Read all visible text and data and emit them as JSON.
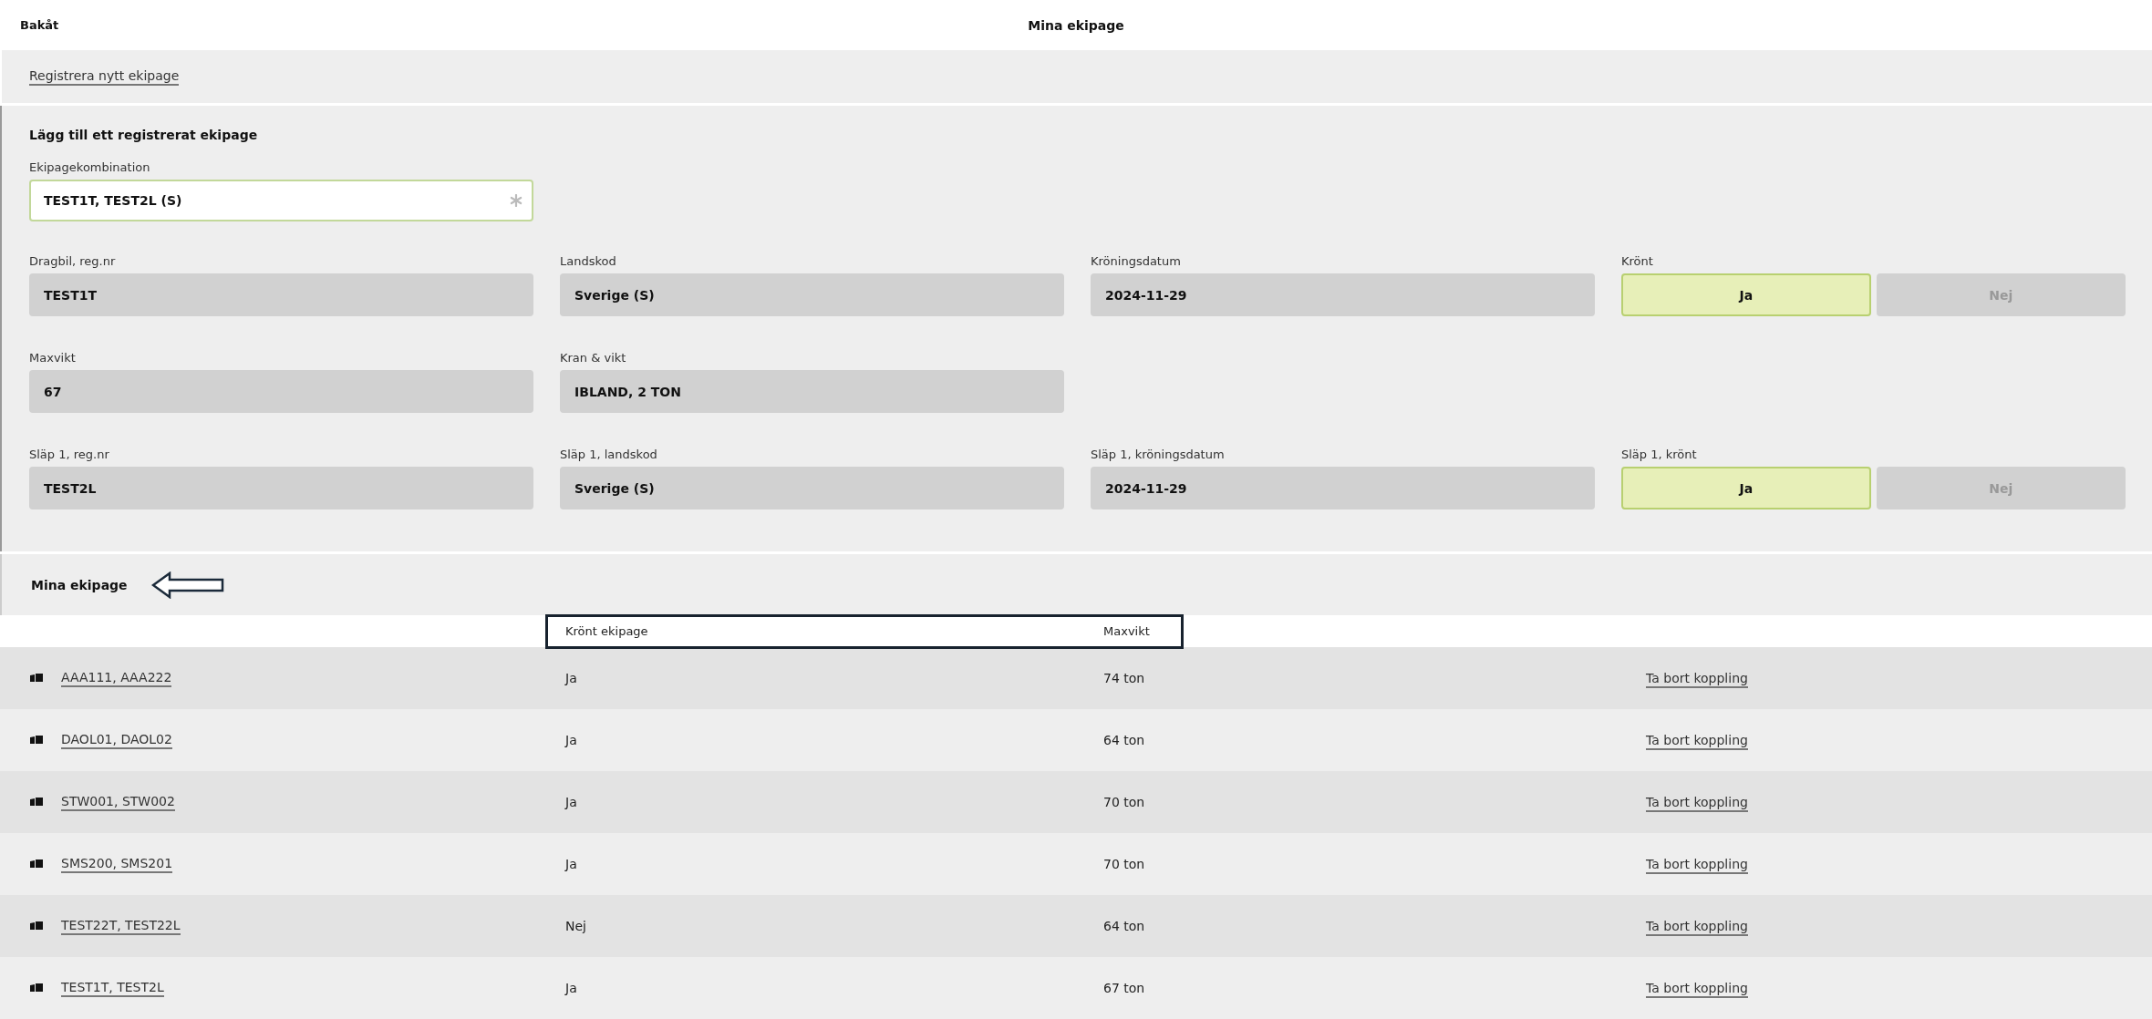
{
  "header": {
    "back": "Bakåt",
    "title": "Mina ekipage"
  },
  "register_link": "Registrera nytt ekipage",
  "form": {
    "heading": "Lägg till ett registrerat ekipage",
    "combination": {
      "label": "Ekipagekombination",
      "value": "TEST1T, TEST2L (S)",
      "required": true
    },
    "rows": [
      [
        {
          "kind": "field",
          "label": "Dragbil, reg.nr",
          "value": "TEST1T"
        },
        {
          "kind": "field",
          "label": "Landskod",
          "value": "Sverige (S)"
        },
        {
          "kind": "field",
          "label": "Kröningsdatum",
          "value": "2024-11-29"
        },
        {
          "kind": "toggle",
          "label": "Krönt",
          "options": [
            {
              "label": "Ja",
              "selected": true
            },
            {
              "label": "Nej",
              "selected": false
            }
          ]
        }
      ],
      [
        {
          "kind": "field",
          "label": "Maxvikt",
          "value": "67"
        },
        {
          "kind": "field",
          "label": "Kran & vikt",
          "value": "IBLAND, 2 TON"
        }
      ],
      [
        {
          "kind": "field",
          "label": "Släp 1, reg.nr",
          "value": "TEST2L"
        },
        {
          "kind": "field",
          "label": "Släp 1, landskod",
          "value": "Sverige (S)"
        },
        {
          "kind": "field",
          "label": "Släp 1, kröningsdatum",
          "value": "2024-11-29"
        },
        {
          "kind": "toggle",
          "label": "Släp 1, krönt",
          "options": [
            {
              "label": "Ja",
              "selected": true
            },
            {
              "label": "Nej",
              "selected": false
            }
          ]
        }
      ]
    ]
  },
  "list": {
    "heading": "Mina ekipage",
    "columns": [
      "Krönt ekipage",
      "Maxvikt"
    ],
    "rows": [
      {
        "name": "AAA111, AAA222",
        "crowned": "Ja",
        "max_weight": "74 ton",
        "action": "Ta bort koppling"
      },
      {
        "name": "DAOL01, DAOL02",
        "crowned": "Ja",
        "max_weight": "64 ton",
        "action": "Ta bort koppling"
      },
      {
        "name": "STW001, STW002",
        "crowned": "Ja",
        "max_weight": "70 ton",
        "action": "Ta bort koppling"
      },
      {
        "name": "SMS200, SMS201",
        "crowned": "Ja",
        "max_weight": "70 ton",
        "action": "Ta bort koppling"
      },
      {
        "name": "TEST22T, TEST22L",
        "crowned": "Nej",
        "max_weight": "64 ton",
        "action": "Ta bort koppling"
      },
      {
        "name": "TEST1T, TEST2L",
        "crowned": "Ja",
        "max_weight": "67 ton",
        "action": "Ta bort koppling"
      }
    ]
  }
}
